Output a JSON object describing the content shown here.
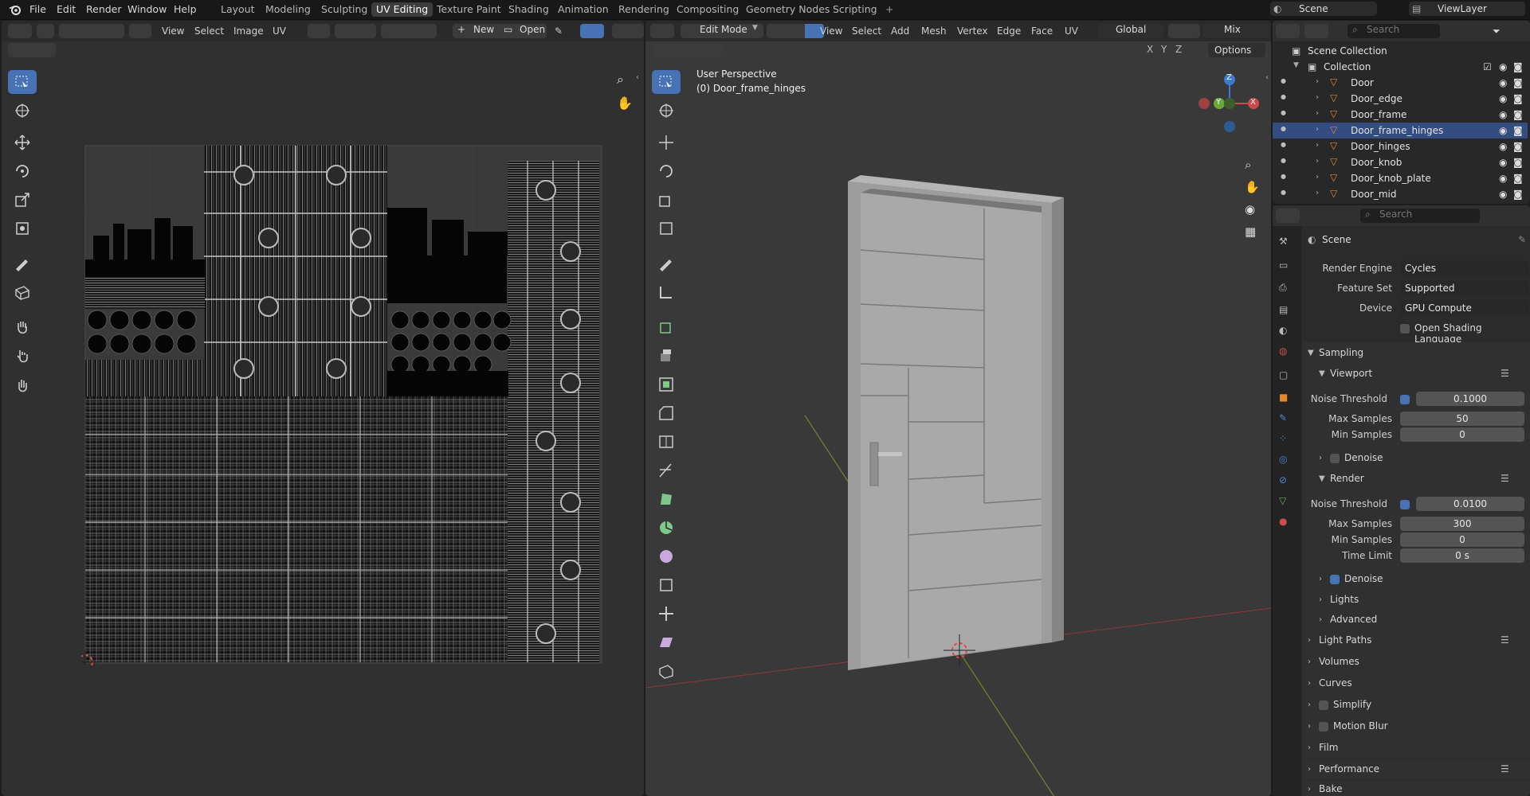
{
  "app": {
    "logo": "blender-logo-icon"
  },
  "topbar": {
    "menus": [
      "File",
      "Edit",
      "Render",
      "Window",
      "Help"
    ],
    "workspaces": [
      "Layout",
      "Modeling",
      "Sculpting",
      "UV Editing",
      "Texture Paint",
      "Shading",
      "Animation",
      "Rendering",
      "Compositing",
      "Geometry Nodes",
      "Scripting"
    ],
    "active_workspace": "UV Editing",
    "add_workspace": "+",
    "scene": "Scene",
    "view_layer": "ViewLayer"
  },
  "uv_editor": {
    "menus": [
      "View",
      "Select",
      "Image",
      "UV"
    ],
    "new_label": "New",
    "open_label": "Open"
  },
  "viewport": {
    "mode": "Edit Mode",
    "menus": [
      "View",
      "Select",
      "Add",
      "Mesh",
      "Vertex",
      "Edge",
      "Face",
      "UV"
    ],
    "orientation": "Global",
    "shading_mix": "Mix",
    "axes": [
      "X",
      "Y",
      "Z"
    ],
    "options_label": "Options",
    "overlay_title": "User Perspective",
    "overlay_object": "(0) Door_frame_hinges",
    "gizmo": {
      "x": "X",
      "y": "Y",
      "z": "Z"
    }
  },
  "outliner": {
    "search_placeholder": "Search",
    "scene_collection": "Scene Collection",
    "collection": "Collection",
    "items": [
      {
        "name": "Door",
        "selected": false
      },
      {
        "name": "Door_edge",
        "selected": false
      },
      {
        "name": "Door_frame",
        "selected": false
      },
      {
        "name": "Door_frame_hinges",
        "selected": true
      },
      {
        "name": "Door_hinges",
        "selected": false
      },
      {
        "name": "Door_knob",
        "selected": false
      },
      {
        "name": "Door_knob_plate",
        "selected": false
      },
      {
        "name": "Door_mid",
        "selected": false
      }
    ]
  },
  "properties": {
    "search_placeholder": "Search",
    "context": "Scene",
    "render_engine_label": "Render Engine",
    "render_engine": "Cycles",
    "feature_set_label": "Feature Set",
    "feature_set": "Supported",
    "device_label": "Device",
    "device": "GPU Compute",
    "osl_label": "Open Shading Language",
    "sampling": "Sampling",
    "viewport_section": "Viewport",
    "render_section": "Render",
    "noise_threshold_label": "Noise Threshold",
    "max_samples_label": "Max Samples",
    "min_samples_label": "Min Samples",
    "time_limit_label": "Time Limit",
    "denoise_label": "Denoise",
    "viewport_noise_threshold": "0.1000",
    "viewport_max_samples": "50",
    "viewport_min_samples": "0",
    "render_noise_threshold": "0.0100",
    "render_max_samples": "300",
    "render_min_samples": "0",
    "render_time_limit": "0 s",
    "subsections": [
      "Lights",
      "Advanced"
    ],
    "panels": [
      "Light Paths",
      "Volumes",
      "Curves",
      "Simplify",
      "Motion Blur",
      "Film",
      "Performance",
      "Bake"
    ]
  },
  "colors": {
    "accent": "#4772b3",
    "selection": "#334d80",
    "panel": "#303030",
    "header": "#2a2a2a"
  }
}
